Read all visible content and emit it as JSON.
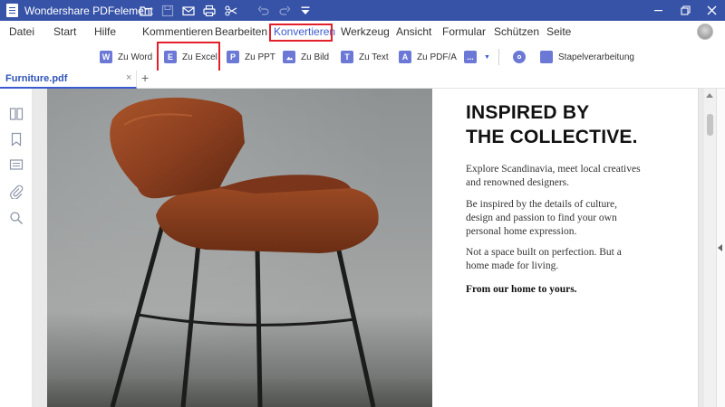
{
  "app": {
    "title": "Wondershare PDFelement"
  },
  "menu": {
    "items": [
      {
        "label": "Datei"
      },
      {
        "label": "Start"
      },
      {
        "label": "Hilfe"
      },
      {
        "label": "Kommentieren"
      },
      {
        "label": "Bearbeiten"
      },
      {
        "label": "Konvertieren"
      },
      {
        "label": "Werkzeug"
      },
      {
        "label": "Ansicht"
      },
      {
        "label": "Formular"
      },
      {
        "label": "Schützen"
      },
      {
        "label": "Seite"
      }
    ],
    "active": "Konvertieren"
  },
  "toolbar": {
    "items": [
      {
        "label": "Zu Word",
        "glyph": "W"
      },
      {
        "label": "Zu Excel",
        "glyph": "E"
      },
      {
        "label": "Zu PPT",
        "glyph": "P"
      },
      {
        "label": "Zu Bild",
        "glyph": ""
      },
      {
        "label": "Zu Text",
        "glyph": "T"
      },
      {
        "label": "Zu PDF/A",
        "glyph": "A"
      },
      {
        "label": "",
        "glyph": "..."
      },
      {
        "label": "",
        "glyph": ""
      },
      {
        "label": "Stapelverarbeitung",
        "glyph": ""
      }
    ],
    "highlighted": "Zu Excel"
  },
  "tabs": {
    "doc_tab": "Furniture.pdf",
    "close_glyph": "×",
    "add_glyph": "+"
  },
  "document": {
    "heading_line1": "INSPIRED BY",
    "heading_line2": "THE COLLECTIVE.",
    "para1_line1": "Explore Scandinavia, meet local creatives",
    "para1_line2": "and renowned designers.",
    "para2_line1": "Be inspired by the details of culture,",
    "para2_line2": "design and passion to find your own",
    "para2_line3": "personal home expression.",
    "para3_line1": "Not a space built on perfection. But a",
    "para3_line2": "home made for living.",
    "para4": "From our home to yours."
  },
  "colors": {
    "titlebar": "#3753a8",
    "accent": "#3a5bd0",
    "highlight_box": "#e2202a",
    "tool_icon": "#6b78d6"
  },
  "icons": {
    "titlebar": [
      "folder-icon",
      "save-icon",
      "mail-icon",
      "print-icon",
      "scissors-icon",
      "undo-icon",
      "redo-icon",
      "quick-access-menu-icon"
    ],
    "window": [
      "minimize-icon",
      "restore-icon",
      "close-icon"
    ],
    "sidebar": [
      "page-thumbnails-icon",
      "bookmark-icon",
      "comment-icon",
      "attachment-icon",
      "search-icon"
    ]
  }
}
